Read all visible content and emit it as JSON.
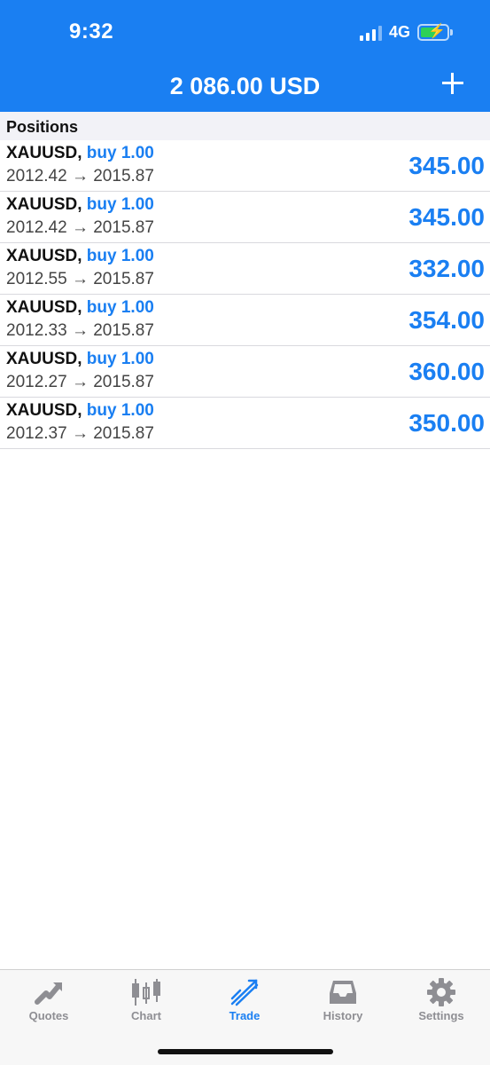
{
  "status": {
    "time": "9:32",
    "network": "4G"
  },
  "header": {
    "balance": "2 086.00 USD"
  },
  "positions_section": {
    "title": "Positions"
  },
  "positions": [
    {
      "symbol": "XAUUSD,",
      "type": "buy 1.00",
      "prices": "2012.42 → 2015.87",
      "profit": "345.00"
    },
    {
      "symbol": "XAUUSD,",
      "type": "buy 1.00",
      "prices": "2012.42 → 2015.87",
      "profit": "345.00"
    },
    {
      "symbol": "XAUUSD,",
      "type": "buy 1.00",
      "prices": "2012.55 → 2015.87",
      "profit": "332.00"
    },
    {
      "symbol": "XAUUSD,",
      "type": "buy 1.00",
      "prices": "2012.33 → 2015.87",
      "profit": "354.00"
    },
    {
      "symbol": "XAUUSD,",
      "type": "buy 1.00",
      "prices": "2012.27 → 2015.87",
      "profit": "360.00"
    },
    {
      "symbol": "XAUUSD,",
      "type": "buy 1.00",
      "prices": "2012.37 → 2015.87",
      "profit": "350.00"
    }
  ],
  "tabs": [
    {
      "label": "Quotes",
      "icon": "quotes-icon"
    },
    {
      "label": "Chart",
      "icon": "candlestick-icon"
    },
    {
      "label": "Trade",
      "icon": "trade-icon",
      "active": true
    },
    {
      "label": "History",
      "icon": "inbox-icon"
    },
    {
      "label": "Settings",
      "icon": "gear-icon"
    }
  ],
  "colors": {
    "accent": "#1a7ff2",
    "inactive": "#8e8e93"
  }
}
